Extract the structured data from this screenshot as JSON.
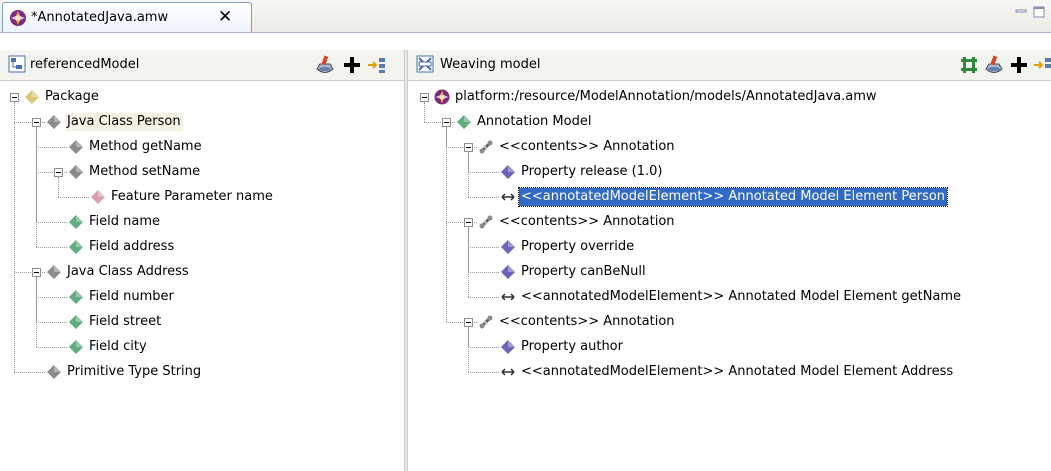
{
  "editor": {
    "tab_title": "*AnnotatedJava.amw",
    "close_glyph": "✕",
    "tab_icon": "amw-file-icon"
  },
  "left_panel": {
    "title": "referencedModel",
    "icon": "tree-view-icon",
    "toolbar": [
      "filter-brush-icon",
      "add-icon",
      "link-element-icon"
    ],
    "tree": [
      {
        "label": "Package",
        "depth": 0,
        "icon": "package-diamond-icon"
      },
      {
        "label": "Java Class Person",
        "depth": 1,
        "icon": "class-diamond-icon"
      },
      {
        "label": "Method getName",
        "depth": 2,
        "icon": "method-diamond-icon"
      },
      {
        "label": "Method setName",
        "depth": 2,
        "icon": "method-diamond-icon"
      },
      {
        "label": "Feature Parameter name",
        "depth": 3,
        "icon": "parameter-diamond-icon"
      },
      {
        "label": "Field name",
        "depth": 2,
        "icon": "field-diamond-icon"
      },
      {
        "label": "Field address",
        "depth": 2,
        "icon": "field-diamond-icon"
      },
      {
        "label": "Java Class Address",
        "depth": 1,
        "icon": "class-diamond-icon"
      },
      {
        "label": "Field number",
        "depth": 2,
        "icon": "field-diamond-icon"
      },
      {
        "label": "Field street",
        "depth": 2,
        "icon": "field-diamond-icon"
      },
      {
        "label": "Field city",
        "depth": 2,
        "icon": "field-diamond-icon"
      },
      {
        "label": "Primitive Type String",
        "depth": 1,
        "icon": "type-diamond-icon"
      }
    ]
  },
  "right_panel": {
    "title": "Weaving model",
    "icon": "weaving-model-icon",
    "toolbar": [
      "synchronize-icon",
      "filter-brush-icon",
      "add-icon",
      "link-element-icon"
    ],
    "tree": [
      {
        "label": "platform:/resource/ModelAnnotation/models/AnnotatedJava.amw",
        "depth": 0,
        "icon": "amw-resource-icon"
      },
      {
        "label": "Annotation Model",
        "depth": 1,
        "icon": "annotation-model-diamond-icon"
      },
      {
        "label": "<<contents>> Annotation",
        "depth": 2,
        "icon": "annotation-link-icon"
      },
      {
        "label": "Property release (1.0)",
        "depth": 3,
        "icon": "property-diamond-icon"
      },
      {
        "label": "<<annotatedModelElement>> Annotated Model Element Person",
        "depth": 3,
        "icon": "element-link-arrow-icon",
        "selected": true
      },
      {
        "label": "<<contents>> Annotation",
        "depth": 2,
        "icon": "annotation-link-icon"
      },
      {
        "label": "Property override",
        "depth": 3,
        "icon": "property-diamond-icon"
      },
      {
        "label": "Property canBeNull",
        "depth": 3,
        "icon": "property-diamond-icon"
      },
      {
        "label": "<<annotatedModelElement>> Annotated Model Element getName",
        "depth": 3,
        "icon": "element-link-arrow-icon"
      },
      {
        "label": "<<contents>> Annotation",
        "depth": 2,
        "icon": "annotation-link-icon"
      },
      {
        "label": "Property author",
        "depth": 3,
        "icon": "property-diamond-icon"
      },
      {
        "label": "<<annotatedModelElement>> Annotated Model Element Address",
        "depth": 3,
        "icon": "element-link-arrow-icon"
      }
    ]
  },
  "colors": {
    "selection": "#316ac5",
    "row_highlight": "#f4f2e4",
    "diamond_gray": "#8c8c8c",
    "diamond_green": "#5fae7d",
    "diamond_purple": "#6a64b8",
    "diamond_pink": "#d8a0a8"
  }
}
